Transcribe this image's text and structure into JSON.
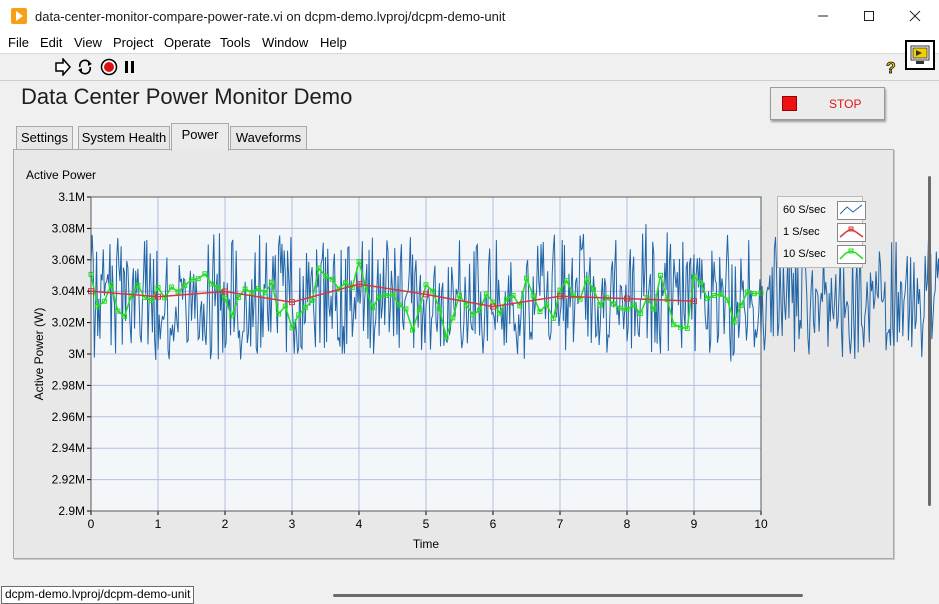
{
  "window": {
    "title": "data-center-monitor-compare-power-rate.vi on dcpm-demo.lvproj/dcpm-demo-unit",
    "controls": [
      "minimize-icon",
      "maximize-icon",
      "close-icon"
    ]
  },
  "menu": [
    "File",
    "Edit",
    "View",
    "Project",
    "Operate",
    "Tools",
    "Window",
    "Help"
  ],
  "toolbar": {
    "icons": [
      "run-arrow-icon",
      "run-continuously-icon",
      "abort-icon",
      "pause-icon",
      "help-icon",
      "vi-icon"
    ]
  },
  "panel": {
    "title": "Data Center Power Monitor Demo",
    "stop_label": "STOP"
  },
  "tabs": [
    {
      "label": "Settings",
      "active": false
    },
    {
      "label": "System Health",
      "active": false
    },
    {
      "label": "Power",
      "active": true
    },
    {
      "label": "Waveforms",
      "active": false
    }
  ],
  "colors": {
    "series_60": "#2165a6",
    "series_1": "#d23a3a",
    "series_10": "#22dd22",
    "plot_bg": "#f4f7fa",
    "grid": "#b9bce0",
    "stop_led": "#ee1111"
  },
  "chart_data": {
    "type": "line",
    "title": "Active Power",
    "xlabel": "Time",
    "ylabel": "Active Power (W)",
    "xlim": [
      0,
      10
    ],
    "ylim": [
      2900000,
      3100000
    ],
    "x_ticks": [
      "0",
      "1",
      "2",
      "3",
      "4",
      "5",
      "6",
      "7",
      "8",
      "9",
      "10"
    ],
    "y_ticks": [
      "2.9M",
      "2.92M",
      "2.94M",
      "2.96M",
      "2.98M",
      "3M",
      "3.02M",
      "3.04M",
      "3.06M",
      "3.08M",
      "3.1M"
    ],
    "grid": true,
    "legend_position": "right",
    "series": [
      {
        "name": "60 S/sec",
        "rate": 60,
        "x_start": 0,
        "values": [
          3057600,
          3075900,
          3059300,
          2997700,
          3027900,
          3065100,
          3011500,
          3035200,
          3009800,
          3050800,
          3046900,
          3066600,
          3037200,
          3045000,
          3046000,
          3050900,
          3044000,
          3070000,
          3005600,
          3056400,
          3037200,
          3032000,
          3000400,
          3061300,
          3073900,
          3055500,
          3046400,
          3068600,
          3006000,
          3055000,
          3051900,
          3021000,
          3059300,
          3055300,
          3037000,
          3018400,
          3006900,
          3044300,
          3054600,
          3016200,
          3053000,
          3038500,
          3054300,
          3036000,
          3011700,
          3007400,
          3031800,
          3049100,
          3071900,
          3038000,
          3072600,
          3006100,
          3034500,
          3064100,
          3036600,
          3013800,
          3060500,
          3008800,
          2996200,
          3065700,
          3002800,
          3025100,
          3009300,
          3019300,
          3024200,
          3021800,
          3025500,
          3044300,
          3061500,
          3002400,
          2996700,
          3016600,
          3011800,
          3018700,
          3008100,
          3018200,
          3030200,
          3020400,
          3013800,
          3056700,
          3045800,
          3047900,
          3034600,
          3048000,
          3047200,
          3028700,
          3007600,
          3008500,
          3038200,
          3053000,
          3021200,
          3037200,
          3050900,
          3022500,
          3047900,
          3034900,
          3009300,
          3010500,
          3028200,
          3033600,
          3008300,
          3032100,
          3012900,
          3005800,
          3028600,
          3069800,
          3036500,
          2996700,
          3002900,
          3053300,
          3076200,
          3030400,
          3041000,
          3051100,
          2996600,
          3077000,
          3027600,
          3041100,
          3000800,
          3045900,
          3003800,
          3007500,
          3045400,
          3029900,
          3034900,
          3011900,
          3070700,
          3072700,
          3014000,
          3025800,
          3065800,
          3027000,
          3010100,
          3015000,
          2996500,
          3007700,
          3014400,
          3014500,
          3046000,
          3032300,
          3007000,
          3013200,
          3037700,
          3004800,
          3047600,
          3017100,
          3033500,
          3064700,
          3003600,
          3000400,
          3028100,
          3075900,
          3004000,
          3037400,
          3010700,
          3044400,
          3041700,
          3070900,
          3027600,
          3014500,
          3047500,
          3013800,
          3041300,
          3062300,
          3040600,
          3063000,
          3028600,
          3013300,
          3069100,
          3075500,
          3051500,
          3070200,
          3043300,
          3066100,
          3051800,
          3001100,
          3065800,
          3049100,
          3032300,
          3074400,
          3032800,
          3020500,
          3000300,
          3022200,
          3014300,
          3000400,
          3003900,
          3054900,
          3004600,
          3003300,
          3049700,
          3019500,
          3020700,
          3064300,
          3032900,
          3058700,
          3030800,
          3049500,
          3055400,
          3034100,
          3019700,
          3004300,
          3066600,
          3042500,
          3051100,
          3007100,
          3057800,
          3060000,
          3070900,
          3003900,
          3061700,
          3007600,
          3067000,
          3030800,
          3023800,
          3037100,
          3016000,
          3056300,
          3063900,
          3027400,
          3040700,
          3008700,
          3010600,
          3004700,
          3066300,
          3000300,
          3017800,
          3000400,
          3060700,
          3006300,
          3067700,
          3068300,
          3027300,
          3046800,
          3010900,
          3022800,
          3036200,
          3022100,
          3054900,
          3032900,
          3046100,
          3032100,
          3045000,
          3071900,
          3014700,
          3034100,
          3044400,
          3057300,
          3009600,
          3066400,
          3003800,
          3026300,
          3074100,
          3000200,
          3015600,
          3021700,
          3041900,
          3060200,
          3011600,
          3051300,
          3022600,
          3030600,
          3061000,
          3018400,
          3043900,
          3072400,
          3065000,
          3013900,
          3028800,
          3053000,
          3041000,
          3011300,
          3067500,
          3043500,
          3012300,
          3049800,
          3003900,
          3057900,
          3069900,
          3021700,
          3015400,
          3034000,
          3036500,
          3038600,
          3039800,
          3051700,
          3074400,
          3032300,
          3063400,
          3003800,
          3050800,
          3059700,
          3036600,
          3016800,
          3038900,
          3050400,
          3002600,
          3023900,
          3034900,
          3007000,
          3030800,
          3035300,
          3041800,
          3033600,
          3002800,
          3022500,
          3024800,
          3048600,
          3056300,
          3020500,
          3014100,
          3031800,
          3045100,
          3004900,
          3040000,
          3045400,
          3005200,
          3015500,
          3009000,
          3007200,
          3055300,
          3012000,
          3016700,
          3055500,
          3046000,
          3029900,
          3023400,
          3041500,
          3037800,
          3040900,
          3072400,
          3017700,
          3003700,
          3008400,
          3021000,
          3049200,
          3031000,
          3006800,
          3023800,
          3057500,
          3020900,
          3016000,
          3015300,
          3065400,
          3012800,
          3068300,
          3069600,
          3040500,
          3011800,
          3039600,
          3015900,
          3000400,
          3011600,
          3036800,
          3036000,
          3008300,
          3055600,
          3067200,
          3035300,
          3025500,
          3026400,
          3023500,
          3015400,
          3072600,
          3020400,
          3047300,
          3033100,
          3027400,
          3015500,
          3031500,
          3005500,
          3039800,
          3007000,
          3032700,
          3050100,
          3019000,
          3058500,
          3030800,
          3032600,
          3014500,
          3019500,
          3009900,
          3000000,
          3025300,
          3011600,
          3023500,
          3039600,
          3038700,
          2996900,
          3027600,
          3055800,
          3059900,
          3035800,
          3009100,
          3014100,
          3009200,
          3049400,
          3024900,
          3032400,
          3039400,
          3068900,
          3046000,
          3037100,
          3070000,
          3049600,
          3071400,
          3038300,
          3022200,
          3037600,
          3052800,
          3011900,
          3008800,
          3014100,
          3050500,
          3066700,
          3076000,
          3026600,
          3023400,
          3039400,
          3017900,
          3024600,
          3030400,
          3072700,
          3021100,
          3069400,
          3002500,
          3035700,
          3016300,
          3051100,
          3029700,
          3041600,
          3061300,
          3007600,
          3025400,
          3045900,
          3048600,
          3031800,
          3035800,
          3075500,
          3066400,
          3067200,
          3076500,
          3047700,
          3021800,
          3052400,
          3011100,
          3050000,
          3061600,
          3007000,
          3033900,
          3049500,
          3038800,
          3011000,
          3012100,
          3033100,
          3005700,
          3017800,
          3036800,
          3048300,
          3022800,
          3048200,
          3043800,
          3000900,
          3012000,
          3011000,
          3031700,
          3053800,
          3059100,
          3029600,
          3054400,
          3072700,
          3024900,
          3030100,
          3018400,
          3043600,
          3042900,
          3032700,
          3015800,
          3028900,
          3044200,
          3008100,
          3016400,
          3054800,
          3066800,
          3003600,
          3052100,
          3062000,
          3011400,
          3033200,
          3026900,
          3013100,
          3010900,
          3034000,
          3035300,
          3076700,
          3036900,
          3052900,
          3082900,
          3010000,
          3036200,
          3044800,
          3050900,
          3001300,
          3071500,
          3064000,
          3007300,
          3038500,
          3006600,
          3044100,
          3014000,
          3000300,
          3046600,
          3036900,
          3041000,
          3058000,
          3040700,
          3077500,
          3001900,
          3059000,
          3070200,
          3017100,
          3033400,
          3060500,
          3050400,
          3042300,
          3052100,
          3031100,
          3060500,
          3026200,
          3003800,
          3071400,
          3025900,
          3017600,
          3054800,
          3058800,
          3019900,
          3057500,
          3061200,
          3022000,
          3049100,
          3063400,
          3001800,
          3051000,
          3061000,
          3042400,
          3061400,
          3035000,
          3060200,
          3038900,
          3045500,
          3024600,
          3016000,
          3016100,
          3040000,
          3000900,
          3008500,
          3065800,
          3039700,
          3058800,
          3047000,
          3045000,
          3007100,
          3012100,
          3061700,
          3036800,
          3048200,
          3041900,
          3012700,
          3035700,
          3056700,
          3075900,
          3055500,
          3012200,
          2995300,
          3057100,
          2998900,
          3001300,
          3055800,
          3022800,
          3033200,
          3010300,
          3021000,
          3060800,
          3040600,
          3046800,
          3030000,
          3024400,
          3008600,
          3020100,
          3072500,
          3029200,
          3040400,
          3032100,
          3029400,
          3004300,
          3015700,
          3010400,
          3016600,
          3026800,
          3047600,
          3010900,
          3043300,
          3017800,
          3002300,
          3012700,
          3038800,
          3042300,
          3041300,
          3050100,
          3013700,
          3055500,
          3011300,
          3066900,
          3074500,
          3051400,
          3011400,
          3018700,
          3060600,
          3030600,
          3011500,
          3057600,
          3033100,
          3021800,
          3040500,
          3061100,
          3022700,
          3065800,
          3059700,
          3032400,
          3051700,
          3001400,
          3067200,
          3024000,
          3056400,
          3009500,
          3021600,
          3016200,
          3072700,
          3074100,
          3056700,
          3053900,
          3037700,
          3010300,
          2999700,
          3026000,
          3043400,
          3053300,
          3020200,
          3013400,
          3041600,
          3040200,
          3037300,
          3014300,
          3031500,
          3038900,
          3033200,
          3063800,
          3037800,
          3045900,
          3037800,
          3004600,
          3038800,
          3020600,
          3048500,
          3027900,
          3022200,
          3034300,
          3050800,
          3016200,
          3020900,
          3039500,
          3063100,
          3016500,
          2998100,
          3055200,
          3023000,
          3029400,
          3033600,
          3030500,
          3010100,
          3000200,
          3010700,
          3062100,
          3023000,
          2996800,
          3046100,
          3059800,
          3001000,
          3048300,
          3066700,
          3018700,
          3016500,
          3004200,
          3024100,
          3029900,
          3046000,
          3029600,
          3007400,
          3051900,
          3040000,
          3046600,
          3028700,
          3034700,
          3052700,
          3038300,
          3035400,
          3065300,
          3057100,
          3034000,
          3033200,
          3035700,
          3046100,
          3002400,
          3013200,
          3013800,
          3015900,
          3005400,
          3071200,
          3016900,
          3005100,
          3034700,
          3071300,
          3007600,
          3039500,
          3013700,
          3046300,
          3044800,
          3011300,
          3033700,
          3038800,
          3049700,
          3062500,
          3008600,
          3027000,
          3061700,
          3004500,
          3030600,
          3058400,
          3016000,
          3021400,
          3048400,
          3031900,
          3041400,
          3023900,
          2998000,
          3018700,
          3023700,
          3062500,
          3040200,
          3046400,
          3073900,
          3047200,
          3063700,
          3009500,
          3022200,
          3036700,
          3040400,
          3065200,
          3048500,
          3060800,
          3043000,
          2996400,
          3008000,
          3052400,
          3063600,
          3023400,
          3012100,
          3048000
        ]
      },
      {
        "name": "1 S/sec",
        "rate": 1,
        "x": [
          0,
          1,
          2,
          3,
          4,
          5,
          6,
          7,
          8,
          9
        ],
        "values": [
          3040000,
          3036500,
          3039800,
          3033000,
          3044500,
          3038000,
          3030200,
          3036800,
          3035300,
          3033700
        ]
      },
      {
        "name": "10 S/sec",
        "rate": 10,
        "x_start": 0,
        "values": [
          3050700,
          3030200,
          3033600,
          3043900,
          3027300,
          3024000,
          3037100,
          3043800,
          3036000,
          3034000,
          3042400,
          3035800,
          3042600,
          3039600,
          3043600,
          3047300,
          3048000,
          3051100,
          3044600,
          3042700,
          3035200,
          3024200,
          3036000,
          3041400,
          3039100,
          3041700,
          3039100,
          3045600,
          3025500,
          3030500,
          3016700,
          3024900,
          3029500,
          3034100,
          3054700,
          3049500,
          3047600,
          3041400,
          3045400,
          3042400,
          3058900,
          3042600,
          3029400,
          3036400,
          3037300,
          3037700,
          3031300,
          3028700,
          3015200,
          3028300,
          3044100,
          3040000,
          3028800,
          3010700,
          3023000,
          3037500,
          3031200,
          3025000,
          3027900,
          3038200,
          3033100,
          3026000,
          3034800,
          3037300,
          3030700,
          3048300,
          3037200,
          3027000,
          3031600,
          3022700,
          3040700,
          3046700,
          3037100,
          3034900,
          3047700,
          3041100,
          3031100,
          3035800,
          3031800,
          3029200,
          3028500,
          3031100,
          3025800,
          3035900,
          3028500,
          3050100,
          3034600,
          3018700,
          3017000,
          3016300,
          3049200,
          3045400,
          3035300,
          3037300,
          3038000,
          3034400,
          3020300,
          3030900,
          3039600,
          3038400,
          3038900
        ]
      }
    ]
  }
}
